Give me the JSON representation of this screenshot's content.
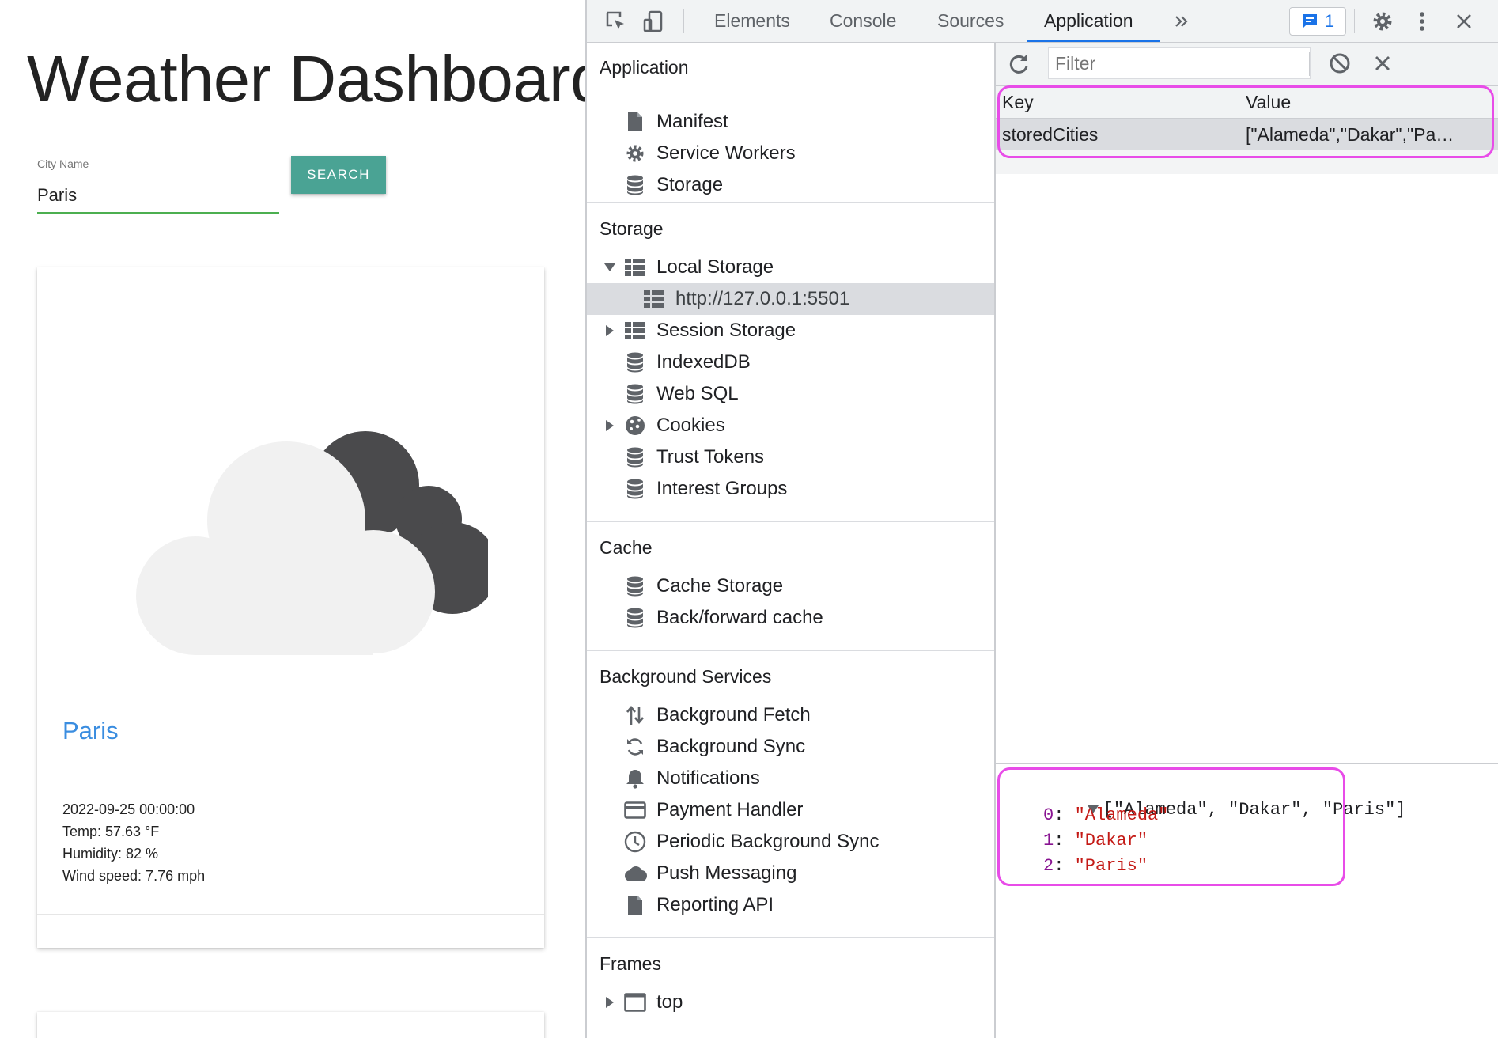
{
  "app": {
    "title": "Weather Dashboard",
    "city_label": "City Name",
    "city_value": "Paris",
    "search_label": "SEARCH",
    "card": {
      "city": "Paris",
      "date": "2022-09-25 00:00:00",
      "temp": "Temp: 57.63 °F",
      "humidity": "Humidity: 82 %",
      "wind": "Wind speed: 7.76 mph"
    }
  },
  "devtools": {
    "tabs": [
      "Elements",
      "Console",
      "Sources",
      "Application"
    ],
    "active_tab": "Application",
    "issues_count": "1",
    "sidebar": {
      "sections": [
        {
          "header": "Application",
          "items": [
            "Manifest",
            "Service Workers",
            "Storage"
          ]
        },
        {
          "header": "Storage",
          "items": [
            "Local Storage",
            "http://127.0.0.1:5501",
            "Session Storage",
            "IndexedDB",
            "Web SQL",
            "Cookies",
            "Trust Tokens",
            "Interest Groups"
          ]
        },
        {
          "header": "Cache",
          "items": [
            "Cache Storage",
            "Back/forward cache"
          ]
        },
        {
          "header": "Background Services",
          "items": [
            "Background Fetch",
            "Background Sync",
            "Notifications",
            "Payment Handler",
            "Periodic Background Sync",
            "Push Messaging",
            "Reporting API"
          ]
        },
        {
          "header": "Frames",
          "items": [
            "top"
          ]
        }
      ],
      "selected": "http://127.0.0.1:5501"
    },
    "filter_placeholder": "Filter",
    "table": {
      "columns": [
        "Key",
        "Value"
      ],
      "rows": [
        {
          "key": "storedCities",
          "value": "[\"Alameda\",\"Dakar\",\"Pa…"
        }
      ]
    },
    "preview": {
      "summary": "[\"Alameda\", \"Dakar\", \"Paris\"]",
      "entries": [
        {
          "index": "0",
          "value": "\"Alameda\""
        },
        {
          "index": "1",
          "value": "\"Dakar\""
        },
        {
          "index": "2",
          "value": "\"Paris\""
        }
      ]
    },
    "colors": {
      "accent": "#1a73e8",
      "highlight": "#e84ce8",
      "search_button": "#4aa394",
      "city_link": "#3a8de0"
    }
  }
}
